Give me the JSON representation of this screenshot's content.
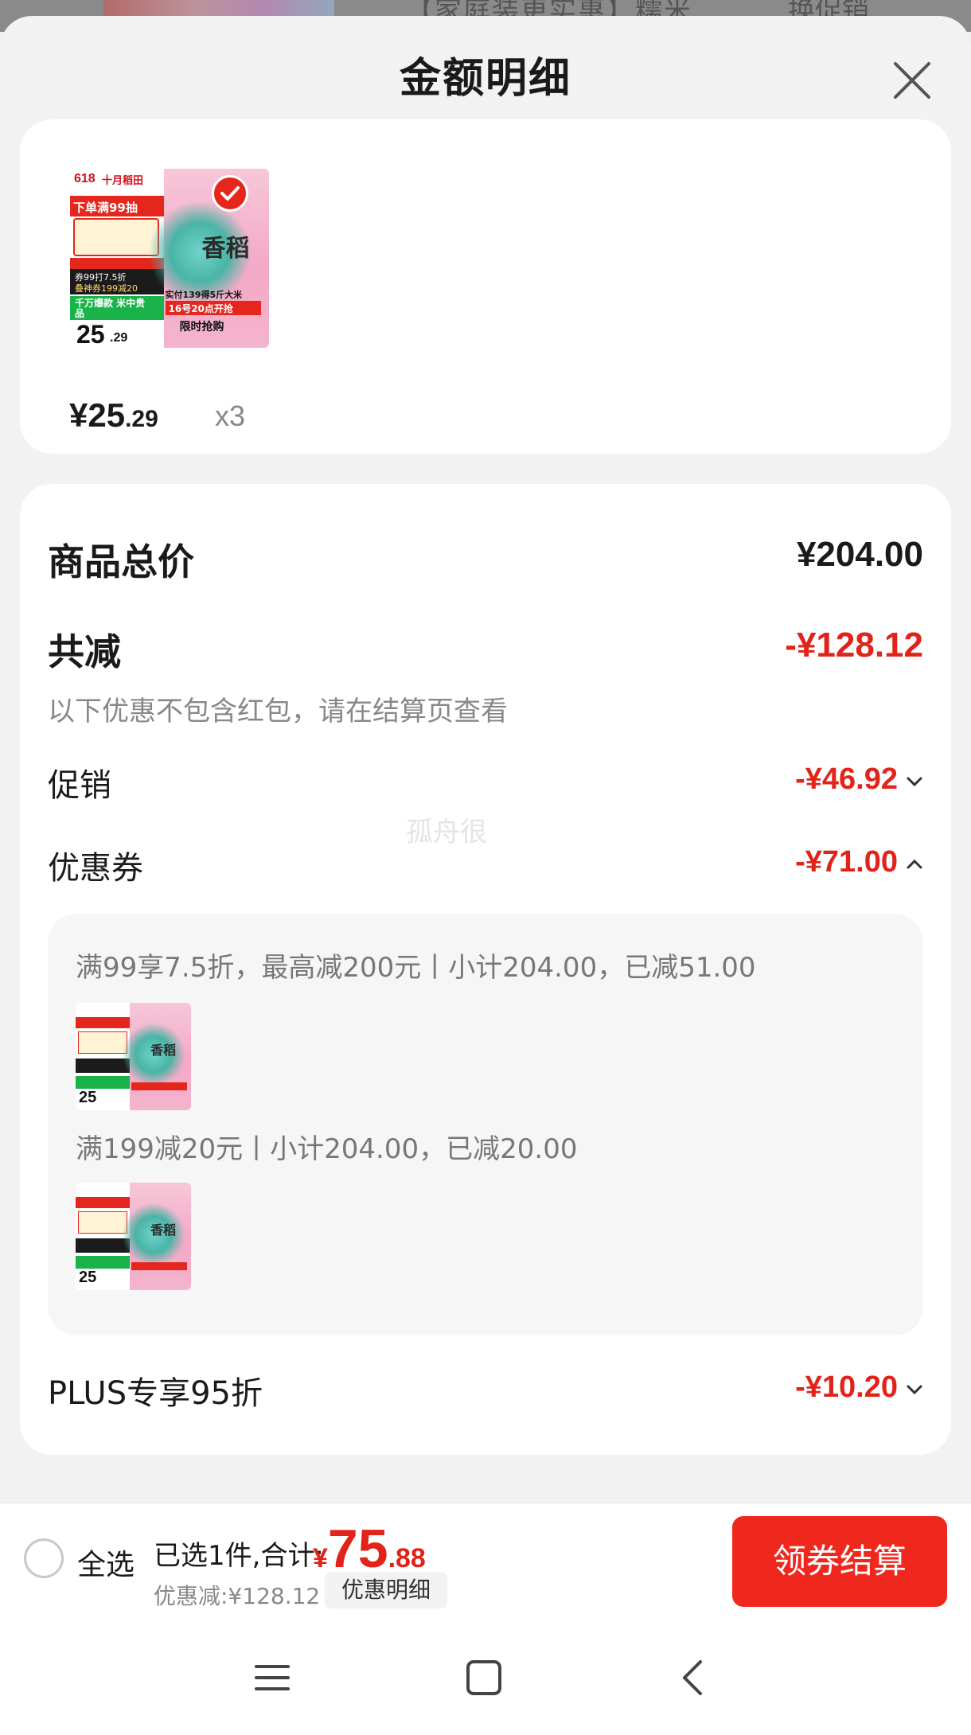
{
  "background": {
    "partial_text_1": "【家庭装更实惠】糯米",
    "partial_text_2": "换促销"
  },
  "sheet": {
    "title": "金额明细",
    "close_icon": "close-icon"
  },
  "product": {
    "price_main": "¥25",
    "price_cents": ".29",
    "quantity": "x3",
    "thumbnail_icon": "rice-product-image",
    "thumb_texts": {
      "badge_618": "618",
      "brand": "十月稻田",
      "promo_1": "下单满99抽",
      "promo_2": "券99打7.5折",
      "promo_3": "叠神券199减20",
      "promo_4": "千万爆款 米中贵品",
      "price_big": "25",
      "price_small": ".29",
      "name_big": "香稻",
      "sub_1": "实付139得5斤大米",
      "sub_2": "16号20点开抢",
      "sub_3": "限时抢购"
    }
  },
  "summary": {
    "total_label": "商品总价",
    "total_value": "¥204.00",
    "reduce_label": "共减",
    "reduce_value": "-¥128.12",
    "note": "以下优惠不包含红包，请在结算页查看",
    "promo_label": "促销",
    "promo_value": "-¥46.92",
    "coupon_label": "优惠券",
    "coupon_value": "-¥71.00",
    "coupon_lines": [
      "满99享7.5折，最高减200元丨小计204.00，已减51.00",
      "满199减20元丨小计204.00，已减20.00"
    ],
    "plus_label": "PLUS专享95折",
    "plus_value": "-¥10.20",
    "chevron_down": "⌄",
    "chevron_up": "⌃"
  },
  "watermark": "孤舟很",
  "bottom": {
    "select_all": "全选",
    "selected_text": "已选1件,合计:",
    "total_currency": "¥",
    "total_int": "75",
    "total_dec": ".88",
    "discount_text": "优惠减:¥128.12",
    "detail_button": "优惠明细",
    "checkout_button": "领券结算"
  },
  "nav": {
    "menu_icon": "menu-icon",
    "home_icon": "home-icon",
    "back_icon": "back-icon"
  },
  "colors": {
    "accent_red": "#e2231a",
    "checkout_red": "#f0271d",
    "text_gray": "#777777"
  }
}
